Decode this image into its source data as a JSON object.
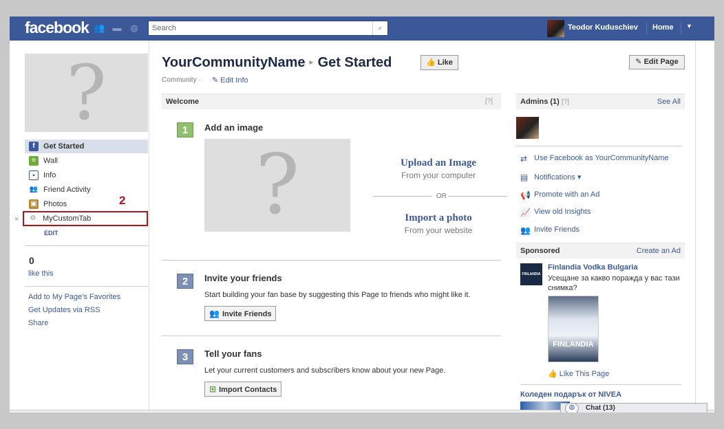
{
  "topbar": {
    "logo": "facebook",
    "search_placeholder": "Search",
    "user_name": "Teodor Kuduschiev",
    "home_label": "Home"
  },
  "left": {
    "nav": [
      {
        "label": "Get Started",
        "icon": "facebook-f-icon"
      },
      {
        "label": "Wall",
        "icon": "wall-icon"
      },
      {
        "label": "Info",
        "icon": "info-icon"
      },
      {
        "label": "Friend Activity",
        "icon": "friends-icon"
      },
      {
        "label": "Photos",
        "icon": "photos-icon"
      },
      {
        "label": "MyCustomTab",
        "icon": "gears-icon"
      }
    ],
    "edit_label": "EDIT",
    "annotation_number": "2",
    "remove_glyph": "×",
    "like_count": "0",
    "like_this": "like this",
    "links": [
      "Add to My Page's Favorites",
      "Get Updates via RSS",
      "Share"
    ]
  },
  "main": {
    "page_name": "YourCommunityName",
    "breadcrumb_sep": "▸",
    "section_title": "Get Started",
    "like_button": "Like",
    "edit_page_button": "Edit Page",
    "category": "Community ·",
    "edit_info": "Edit Info",
    "welcome": {
      "title": "Welcome",
      "help": "[?]"
    },
    "steps": [
      {
        "num": "1",
        "title": "Add an image",
        "color": "#8fbf6f"
      },
      {
        "num": "2",
        "title": "Invite your friends",
        "color": "#7d8fb5",
        "desc": "Start building your fan base by suggesting this Page to friends who might like it.",
        "button": "Invite Friends"
      },
      {
        "num": "3",
        "title": "Tell your fans",
        "color": "#7d8fb5",
        "desc": "Let your current customers and subscribers know about your new Page.",
        "button": "Import Contacts"
      }
    ],
    "upload": {
      "title": "Upload an Image",
      "sub": "From your computer"
    },
    "or_text": "OR",
    "import": {
      "title": "Import a photo",
      "sub": "From your website"
    }
  },
  "right": {
    "admins": {
      "title": "Admins (1)",
      "help": "[?]",
      "see_all": "See All"
    },
    "actions": [
      {
        "label": "Use Facebook as YourCommunityName",
        "icon": "switch-user-icon"
      },
      {
        "label": "Notifications ▾",
        "icon": "notifications-icon"
      },
      {
        "label": "Promote with an Ad",
        "icon": "megaphone-icon"
      },
      {
        "label": "View old Insights",
        "icon": "insights-icon"
      },
      {
        "label": "Invite Friends",
        "icon": "friends-icon"
      }
    ],
    "sponsored": {
      "title": "Sponsored",
      "create_ad": "Create an Ad"
    },
    "ad": {
      "title": "Finlandia Vodka Bulgaria",
      "text": "Усещане за какво поражда у вас тази снимка?",
      "image_label": "FINLANDIA",
      "logo_label": "FINLANDIA",
      "like": "Like This Page"
    },
    "ad2": {
      "title": "Коледен подарък от NIVEA"
    }
  },
  "chat": {
    "label": "Chat (13)"
  },
  "colors": {
    "brand": "#3b5998",
    "annotation": "#b0141b"
  }
}
